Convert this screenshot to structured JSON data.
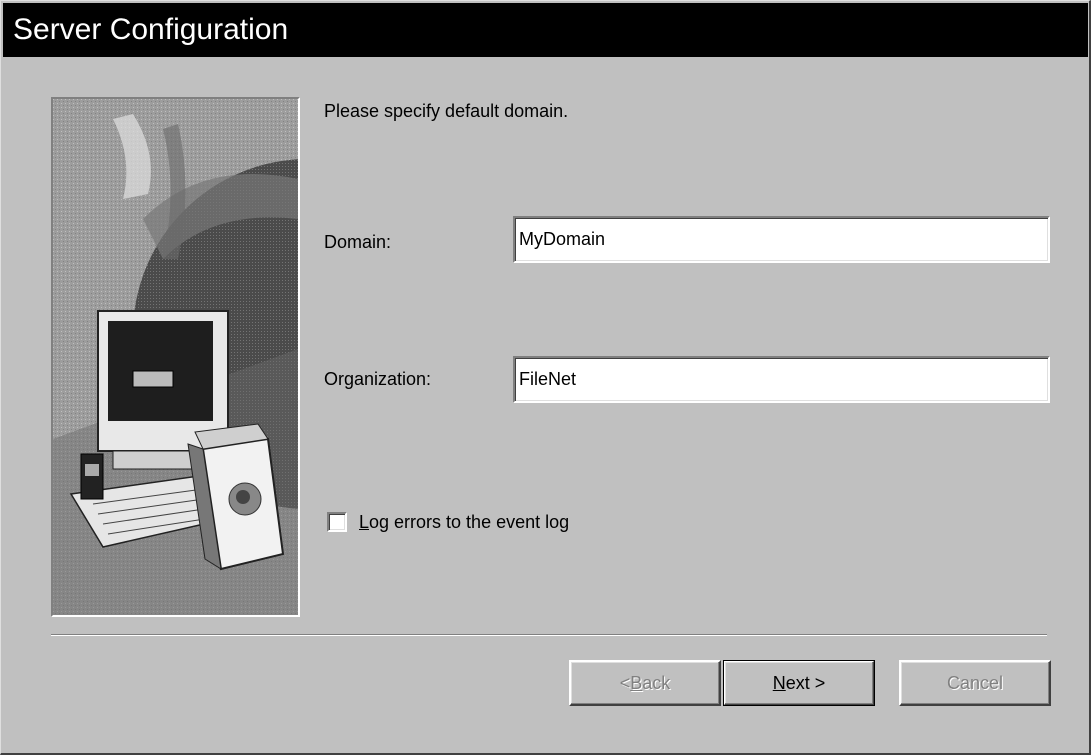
{
  "window": {
    "title": "Server Configuration"
  },
  "content": {
    "instruction": "Please specify default domain."
  },
  "form": {
    "domain_label": "Domain:",
    "domain_value": "MyDomain",
    "organization_label": "Organization:",
    "organization_value": "FileNet",
    "log_errors_label": "Log errors to the event log",
    "log_errors_checked": false
  },
  "buttons": {
    "back": {
      "prefix": "< ",
      "mnemonic": "B",
      "rest": "ack",
      "enabled": false
    },
    "next": {
      "mnemonic": "N",
      "rest": "ext >",
      "enabled": true
    },
    "cancel": {
      "label": "Cancel",
      "enabled": false
    }
  },
  "colors": {
    "titlebar_bg": "#000000",
    "titlebar_text": "#ffffff",
    "dialog_bg": "#c0c0c0"
  },
  "icons": {
    "wizard_art": "computer-globe-illustration"
  }
}
